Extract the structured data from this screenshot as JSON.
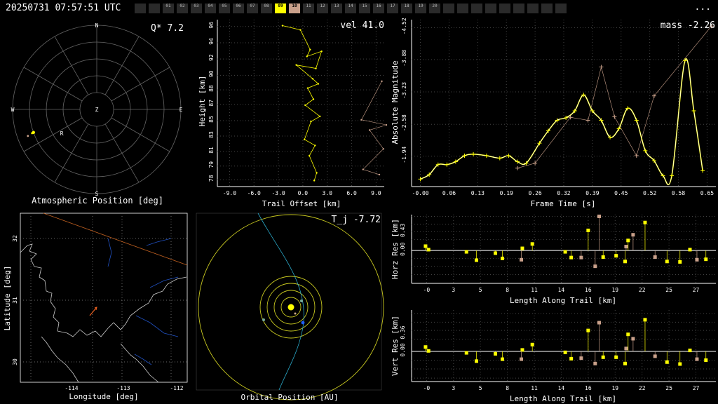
{
  "header": {
    "timestamp": "20250731 07:57:51 UTC",
    "menu_label": "..."
  },
  "tabs": [
    "",
    "",
    "01",
    "02",
    "03",
    "04",
    "05",
    "06",
    "07",
    "08",
    "09",
    "10",
    "11",
    "12",
    "13",
    "14",
    "15",
    "16",
    "17",
    "18",
    "19",
    "20",
    "",
    "",
    "",
    "",
    "",
    "",
    "",
    "",
    ""
  ],
  "active_tab": "09",
  "alt_tab": "10",
  "colors": {
    "accent": "#ffff00",
    "secondary": "#c9a08a",
    "line": "#ffffff",
    "ground": "#2050c0",
    "orbit": "#c8c820",
    "track": "#2aa8c8"
  },
  "chart_data": [
    {
      "type": "scatter",
      "id": "atmospheric",
      "title_corner": "Q*  7.2",
      "xlabel": "Atmospheric Position [deg]",
      "compass": [
        "N",
        "E",
        "S",
        "W",
        "Z"
      ],
      "points": [
        {
          "az": 250,
          "alt": 18,
          "label": "R"
        }
      ],
      "annotations": [
        "R"
      ],
      "grid": true
    },
    {
      "type": "line",
      "id": "height",
      "title_corner": "vel 41.0",
      "xlabel": "Trail Offset [km]",
      "ylabel": "Height [km]",
      "xlim": [
        -10.5,
        10
      ],
      "ylim": [
        77,
        96.5
      ],
      "xticks": [
        "-9.0",
        "-6.0",
        "-3.0",
        "0.0",
        "3.0",
        "6.0",
        "9.0"
      ],
      "yticks": [
        "78",
        "79",
        "81",
        "83",
        "85",
        "87",
        "88",
        "90",
        "92",
        "94",
        "96"
      ],
      "series": [
        {
          "color": "yellow",
          "x": [
            -2.5,
            -0.3,
            0.9,
            0.5,
            2.3,
            1.6,
            -0.8,
            1.2,
            1.9,
            0.6,
            1.3,
            0.3,
            2.1,
            1.0,
            0.2,
            1.5,
            0.8,
            1.7,
            1.4
          ],
          "y": [
            95.8,
            95.3,
            93.0,
            92.2,
            92.8,
            90.8,
            91.2,
            89.6,
            89.0,
            88.5,
            87.2,
            86.5,
            85.2,
            84.6,
            82.5,
            81.8,
            80.6,
            78.6,
            77.7
          ]
        },
        {
          "color": "brown",
          "x": [
            9.7,
            7.2,
            10.3,
            8.2,
            9.9,
            7.4,
            9.4
          ],
          "y": [
            89.3,
            84.8,
            84.2,
            83.6,
            81.4,
            79.0,
            78.4
          ]
        }
      ]
    },
    {
      "type": "line",
      "id": "magnitude",
      "title_corner": "mass -2.26",
      "xlabel": "Frame Time [s]",
      "ylabel": "Absolute Magnitude",
      "xlim": [
        -0.02,
        0.67
      ],
      "ylim": [
        -1.33,
        -4.68
      ],
      "xticks": [
        "-0.00",
        "0.06",
        "0.13",
        "0.19",
        "0.26",
        "0.32",
        "0.39",
        "0.45",
        "0.52",
        "0.58",
        "0.65"
      ],
      "yticks": [
        "-1.94",
        "-2.58",
        "-3.23",
        "-3.88",
        "-4.52"
      ],
      "series": [
        {
          "name": "",
          "color": "yellow",
          "x": [
            0.0,
            0.02,
            0.04,
            0.06,
            0.08,
            0.1,
            0.12,
            0.15,
            0.18,
            0.2,
            0.22,
            0.24,
            0.27,
            0.29,
            0.31,
            0.33,
            0.35,
            0.37,
            0.39,
            0.41,
            0.43,
            0.45,
            0.47,
            0.49,
            0.51,
            0.53,
            0.55,
            0.57,
            0.6,
            0.62,
            0.64
          ],
          "y": [
            -1.48,
            -1.57,
            -1.77,
            -1.77,
            -1.83,
            -1.95,
            -1.98,
            -1.95,
            -1.9,
            -1.95,
            -1.83,
            -1.8,
            -2.2,
            -2.45,
            -2.66,
            -2.71,
            -2.85,
            -3.17,
            -2.85,
            -2.66,
            -2.32,
            -2.49,
            -2.9,
            -2.66,
            -2.05,
            -1.85,
            -1.55,
            -1.55,
            -3.86,
            -2.85,
            -1.65
          ]
        },
        {
          "name": "",
          "color": "brown",
          "x": [
            0.22,
            0.26,
            0.34,
            0.38,
            0.41,
            0.44,
            0.49,
            0.53,
            0.66
          ],
          "y": [
            -1.7,
            -1.8,
            -2.72,
            -2.66,
            -3.73,
            -2.73,
            -1.95,
            -3.15,
            -4.55
          ]
        }
      ]
    },
    {
      "type": "map",
      "id": "ground",
      "xlabel": "Longitude [deg]",
      "ylabel": "Latitude [deg]",
      "xticks": [
        "-114",
        "-113",
        "-112"
      ],
      "yticks": [
        "32",
        "31",
        "30"
      ]
    },
    {
      "type": "scatter",
      "id": "orbit",
      "title_corner": "T_j -7.72",
      "xlabel": "Orbital Position [AU]"
    },
    {
      "type": "scatter",
      "id": "horz_res",
      "xlabel": "Length Along Trail [km]",
      "ylabel": "Horz Res [km]",
      "xlim": [
        -1.5,
        29
      ],
      "ylim": [
        -0.75,
        0.82
      ],
      "xticks": [
        "-0",
        "3",
        "5",
        "8",
        "11",
        "14",
        "16",
        "19",
        "22",
        "25",
        "27"
      ],
      "yticks": [
        "0.00",
        "0.43"
      ],
      "series": [
        {
          "color": "yellow",
          "x": [
            -0.1,
            0.2,
            4,
            5,
            6.9,
            7.6,
            9.6,
            10.6,
            13.9,
            14.5,
            16.2,
            17.7,
            19,
            19.9,
            20.2,
            21.9,
            24.1,
            25.4,
            26.4,
            28
          ],
          "y": [
            0.1,
            0.02,
            -0.03,
            -0.22,
            -0.06,
            -0.18,
            0.05,
            0.15,
            -0.03,
            -0.16,
            0.46,
            -0.15,
            -0.12,
            -0.25,
            0.23,
            0.64,
            -0.25,
            -0.26,
            0.02,
            -0.2
          ]
        },
        {
          "color": "brown",
          "x": [
            9.5,
            15.5,
            16.9,
            17.3,
            20,
            20.7,
            22.9,
            27.1
          ],
          "y": [
            -0.21,
            -0.16,
            -0.36,
            0.78,
            0.09,
            0.36,
            -0.15,
            -0.21
          ]
        }
      ]
    },
    {
      "type": "scatter",
      "id": "vert_res",
      "xlabel": "Length Along Trail [km]",
      "ylabel": "Vert Res [km]",
      "xlim": [
        -1.5,
        29
      ],
      "ylim": [
        -0.62,
        0.85
      ],
      "xticks": [
        "-0",
        "3",
        "5",
        "8",
        "11",
        "14",
        "16",
        "19",
        "22",
        "25",
        "27"
      ],
      "yticks": [
        "0.00",
        "0.36"
      ],
      "series": [
        {
          "color": "yellow",
          "x": [
            -0.1,
            0.2,
            4,
            5,
            6.9,
            7.6,
            9.6,
            10.6,
            13.9,
            14.5,
            16.2,
            17.7,
            19,
            19.9,
            20.2,
            21.9,
            24.1,
            25.4,
            26.4,
            28
          ],
          "y": [
            0.09,
            0.01,
            -0.03,
            -0.2,
            -0.05,
            -0.16,
            0.03,
            0.14,
            -0.02,
            -0.15,
            0.43,
            -0.12,
            -0.12,
            -0.25,
            0.35,
            0.65,
            -0.22,
            -0.26,
            0.02,
            -0.18
          ]
        },
        {
          "color": "brown",
          "x": [
            9.5,
            15.5,
            16.9,
            17.3,
            20,
            20.7,
            22.9,
            27.1
          ],
          "y": [
            -0.16,
            -0.14,
            -0.25,
            0.59,
            0.06,
            0.26,
            -0.1,
            -0.16
          ]
        }
      ]
    }
  ]
}
